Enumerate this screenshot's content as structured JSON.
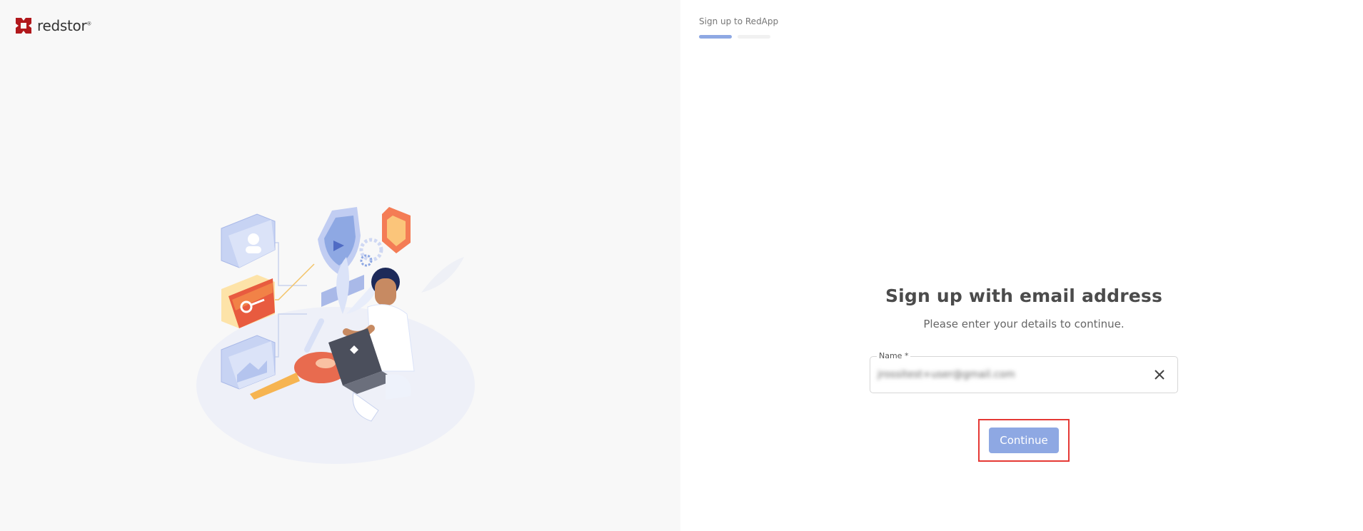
{
  "brand": {
    "name": "redstor",
    "mark": "®",
    "logo_color": "#b1181c"
  },
  "illustration": {
    "description_icon": "security-illustration-icon"
  },
  "signup": {
    "step_label": "Sign up to RedApp",
    "progress": {
      "current_step": 1,
      "total_steps": 2
    },
    "title": "Sign up with email address",
    "subtitle": "Please enter your details to continue.",
    "name_field": {
      "label": "Name *",
      "value": "jrossitest+user@gmail.com"
    },
    "clear_icon": "close-icon",
    "continue_label": "Continue"
  },
  "colors": {
    "accent": "#8ea8e3",
    "highlight_border": "#e53935",
    "left_bg": "#f8f8f8"
  }
}
